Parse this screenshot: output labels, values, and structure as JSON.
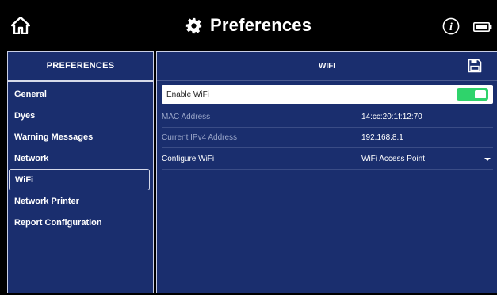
{
  "header": {
    "title": "Preferences",
    "icons": [
      "home-icon",
      "gear-icon",
      "info-icon",
      "battery-icon"
    ]
  },
  "sidebar": {
    "title": "PREFERENCES",
    "items": [
      {
        "label": "General"
      },
      {
        "label": "Dyes"
      },
      {
        "label": "Warning Messages"
      },
      {
        "label": "Network"
      },
      {
        "label": "WiFi",
        "active": true
      },
      {
        "label": "Network Printer"
      },
      {
        "label": "Report Configuration"
      }
    ]
  },
  "main": {
    "title": "WIFI",
    "enable": {
      "label": "Enable WiFi",
      "enabled": true
    },
    "rows": [
      {
        "label": "MAC Address",
        "value": "14:cc:20:1f:12:70"
      },
      {
        "label": "Current IPv4 Address",
        "value": "192.168.8.1"
      },
      {
        "label": "Configure WiFi",
        "value": "WiFi Access Point"
      }
    ]
  },
  "colors": {
    "panel_bg": "#1a2e6e",
    "toggle_on": "#2fd36b",
    "top_bar": "#000000"
  }
}
